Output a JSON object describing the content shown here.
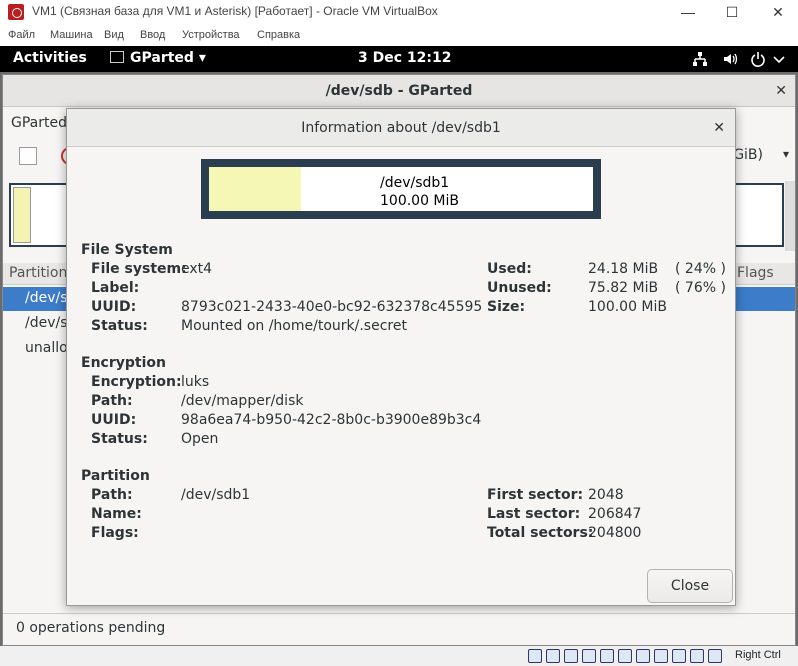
{
  "vbox": {
    "title": "VM1 (Связная база для VM1 и Asterisk) [Работает] - Oracle VM VirtualBox",
    "menu": [
      "Файл",
      "Машина",
      "Вид",
      "Ввод",
      "Устройства",
      "Справка"
    ],
    "controls": {
      "minimize": "—",
      "maximize": "☐",
      "close": "✕"
    },
    "host_key": "Right Ctrl"
  },
  "gnome": {
    "activities": "Activities",
    "app_name": "GParted",
    "app_arrow": "▾",
    "clock": "3 Dec  12:12",
    "tray_icons": [
      "network-icon",
      "volume-icon",
      "power-icon",
      "power-menu-icon"
    ]
  },
  "gparted": {
    "window_title": "/dev/sdb - GParted",
    "close": "✕",
    "menu_partial": "GParted",
    "device_partial": "GiB)",
    "device_arrow": "▾",
    "columns": {
      "partition": "Partition",
      "flags": "Flags"
    },
    "rows": [
      "/dev/sc",
      "/dev/sc",
      "unalloc"
    ],
    "status": "0 operations pending"
  },
  "dialog": {
    "title": "Information about /dev/sdb1",
    "close": "✕",
    "visual": {
      "name": "/dev/sdb1",
      "size": "100.00 MiB",
      "used_fraction": 0.24
    },
    "file_system": {
      "title": "File System",
      "labels": {
        "fs": "File system:",
        "label": "Label:",
        "uuid": "UUID:",
        "status": "Status:",
        "used": "Used:",
        "unused": "Unused:",
        "size": "Size:"
      },
      "values": {
        "fs": "ext4",
        "uuid": "8793c021-2433-40e0-bc92-632378c45595",
        "status": "Mounted on /home/tourk/.secret",
        "used": "24.18 MiB",
        "used_pct": "( 24% )",
        "unused": "75.82 MiB",
        "unused_pct": "( 76% )",
        "size": "100.00 MiB"
      }
    },
    "encryption": {
      "title": "Encryption",
      "labels": {
        "encryption": "Encryption:",
        "path": "Path:",
        "uuid": "UUID:",
        "status": "Status:"
      },
      "values": {
        "encryption": "luks",
        "path": "/dev/mapper/disk",
        "uuid": "98a6ea74-b950-42c2-8b0c-b3900e89b3c4",
        "status": "Open"
      }
    },
    "partition": {
      "title": "Partition",
      "labels": {
        "path": "Path:",
        "name": "Name:",
        "flags": "Flags:",
        "first": "First sector:",
        "last": "Last sector:",
        "total": "Total sectors:"
      },
      "values": {
        "path": "/dev/sdb1",
        "first": "2048",
        "last": "206847",
        "total": "204800"
      }
    },
    "close_button": "Close"
  }
}
